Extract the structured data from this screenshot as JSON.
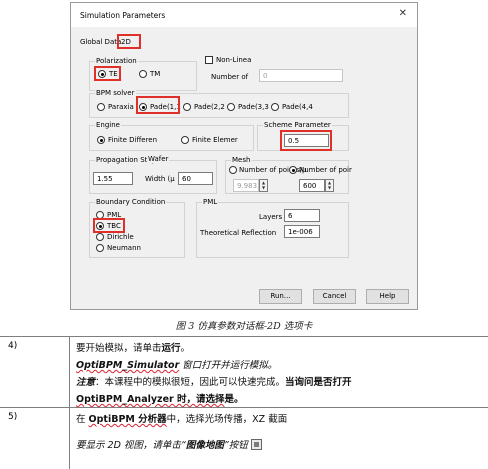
{
  "dialog": {
    "title": "Simulation Parameters",
    "close_glyph": "✕",
    "global_data_label": "Global Data",
    "global_data_value": "2D",
    "polarization": {
      "legend": "Polarization",
      "te": "TE",
      "tm": "TM",
      "selected": "TE"
    },
    "nonlinear": {
      "label": "Non-Linea",
      "checked": false,
      "number_label": "Number of",
      "number_value": "0"
    },
    "bpm_solver": {
      "legend": "BPM solver",
      "options": [
        "Paraxia",
        "Pade(1,1",
        "Pade(2,2",
        "Pade(3,3",
        "Pade(4,4"
      ],
      "selected": "Pade(1,1"
    },
    "engine": {
      "legend": "Engine",
      "fd": "Finite Differen",
      "fe": "Finite Elemer",
      "selected": "Finite Differen"
    },
    "scheme": {
      "legend": "Scheme Parameter",
      "value": "0.5"
    },
    "propagation": {
      "legend": "Propagation Step",
      "step_value": "1.55",
      "wafer_label": "Wafer",
      "width_label": "Width (µ",
      "width_value": "60"
    },
    "mesh": {
      "legend": "Mesh",
      "points_label": "Number of points/µ",
      "points_value": "9.9833",
      "number_label": "Number of poir",
      "number_value": "600",
      "selected": "number"
    },
    "boundary": {
      "legend": "Boundary Condition",
      "options": [
        "PML",
        "TBC",
        "Dirichle",
        "Neumann"
      ],
      "selected": "TBC"
    },
    "pml": {
      "legend": "PML",
      "layers_label": "Layers",
      "layers_value": "6",
      "reflection_label": "Theoretical Reflection",
      "reflection_value": "1e-006"
    },
    "buttons": {
      "run": "Run...",
      "cancel": "Cancel",
      "help": "Help"
    },
    "spin_up": "▲",
    "spin_down": "▼"
  },
  "caption": "图 3  仿真参数对话框-2D 选项卡",
  "steps": [
    {
      "number": "4)",
      "lines": {
        "l1_a": "要开始模拟，请单击",
        "l1_b": "运行",
        "l1_c": "。",
        "l2_a": "OptiBPM_Simulator",
        "l2_b": " 窗口打开并运行模拟。",
        "l3_a": "注意",
        "l3_b": "：本课程中的模拟很短，因此可以快速完成。",
        "l3_c": "当询问是否打开",
        "l4_a": "OptiBPM_Analyzer 时，请选择",
        "l4_b": "是",
        "l4_c": "。"
      }
    },
    {
      "number": "5)",
      "lines": {
        "l1_a": "在 ",
        "l1_b": "OptiBPM 分析器",
        "l1_c": "中，选择光场传播，XZ 截面",
        "l2_a": "要显示 2D 视图，请单击“",
        "l2_b": "图像地图",
        "l2_c": "”按钮"
      }
    }
  ],
  "colors": {
    "highlight": "#e0302a",
    "dialog_bg": "#f0f0f0"
  }
}
